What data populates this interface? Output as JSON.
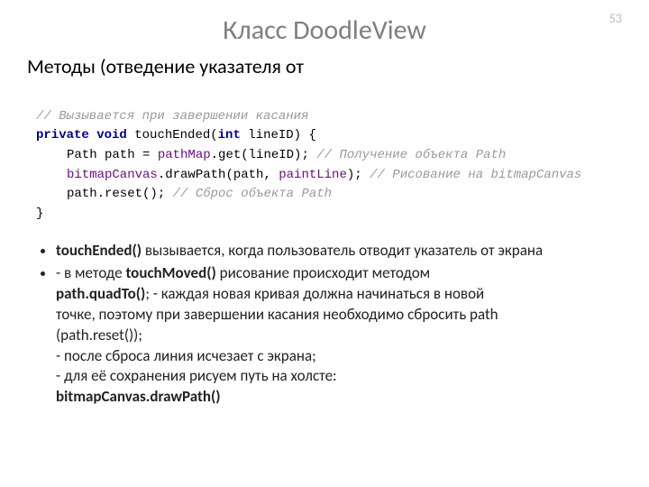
{
  "page_number": "53",
  "title": "Класс DoodleView",
  "subtitle": "Методы (отведение указателя от",
  "code": {
    "c1": "// Вызывается при завершении касания",
    "kw_private": "private",
    "kw_void": "void",
    "method_name": "touchEnded",
    "open_paren": "(",
    "kw_int": "int",
    "param": " lineID) {",
    "l3a": "Path path = ",
    "l3b": "pathMap",
    "l3c": ".get(lineID); ",
    "l3d": "// Получение объекта Path",
    "l4a": "bitmapCanvas",
    "l4b": ".drawPath(path, ",
    "l4c": "paintLine",
    "l4d": "); ",
    "l4e": "// Рисование на bitmapCanvas",
    "l5a": "path.reset(); ",
    "l5b": "// Сброс объекта Path",
    "close": "}"
  },
  "bullets": {
    "b1a": "touchEnded()",
    "b1b": " вызывается, когда пользователь отводит указатель от экрана",
    "b2a": "- в методе ",
    "b2b": "touchMoved()",
    "b2c": " рисование происходит методом",
    "b2d": "   path.quadTo()",
    "b2e": "; - каждая новая кривая должна начинаться в новой",
    "b2f": "   точке, поэтому при завершении касания необходимо сбросить path",
    "b2g": "   (path.reset());",
    "b2h": "- после сброса линия исчезает с экрана;",
    "b2i": "- для её сохранения рисуем путь на холсте:",
    "b2j": "bitmapCanvas.drawPath()"
  }
}
